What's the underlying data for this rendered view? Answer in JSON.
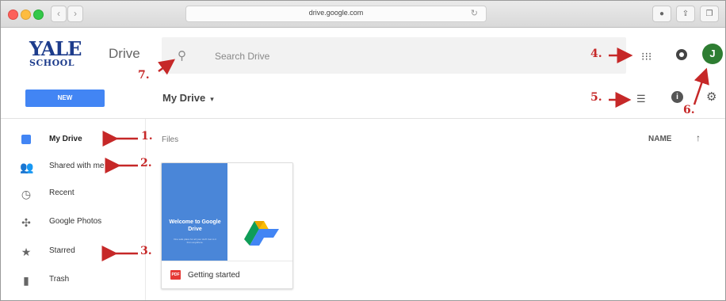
{
  "browser": {
    "url": "drive.google.com",
    "back_icon": "chevron-left-icon",
    "forward_icon": "chevron-right-icon"
  },
  "header": {
    "logo_line1": "YALE",
    "logo_line2": "SCHOOL",
    "app_title": "Drive",
    "search_placeholder": "Search Drive",
    "avatar_initial": "J"
  },
  "toolbar": {
    "new_label": "NEW",
    "breadcrumb": "My Drive",
    "caret": "▾"
  },
  "sidebar": {
    "items": [
      {
        "label": "My Drive",
        "icon": "drive-icon"
      },
      {
        "label": "Shared with me",
        "icon": "people-icon"
      },
      {
        "label": "Recent",
        "icon": "clock-icon"
      },
      {
        "label": "Google Photos",
        "icon": "pinwheel-icon"
      },
      {
        "label": "Starred",
        "icon": "star-icon"
      },
      {
        "label": "Trash",
        "icon": "trash-icon"
      }
    ]
  },
  "main": {
    "files_label": "Files",
    "sort_label": "NAME",
    "sort_arrow": "↑",
    "files": [
      {
        "name": "Getting started",
        "type_badge": "PDF",
        "thumb_title": "Welcome to Google Drive",
        "thumb_subtitle": "One safe place for all your stuff. Get to it from anywhere."
      }
    ]
  },
  "annotations": [
    "1.",
    "2.",
    "3.",
    "4.",
    "5.",
    "6.",
    "7."
  ],
  "colors": {
    "accent": "#4285f4",
    "annotation": "#c62828",
    "avatar": "#2e7d32"
  }
}
